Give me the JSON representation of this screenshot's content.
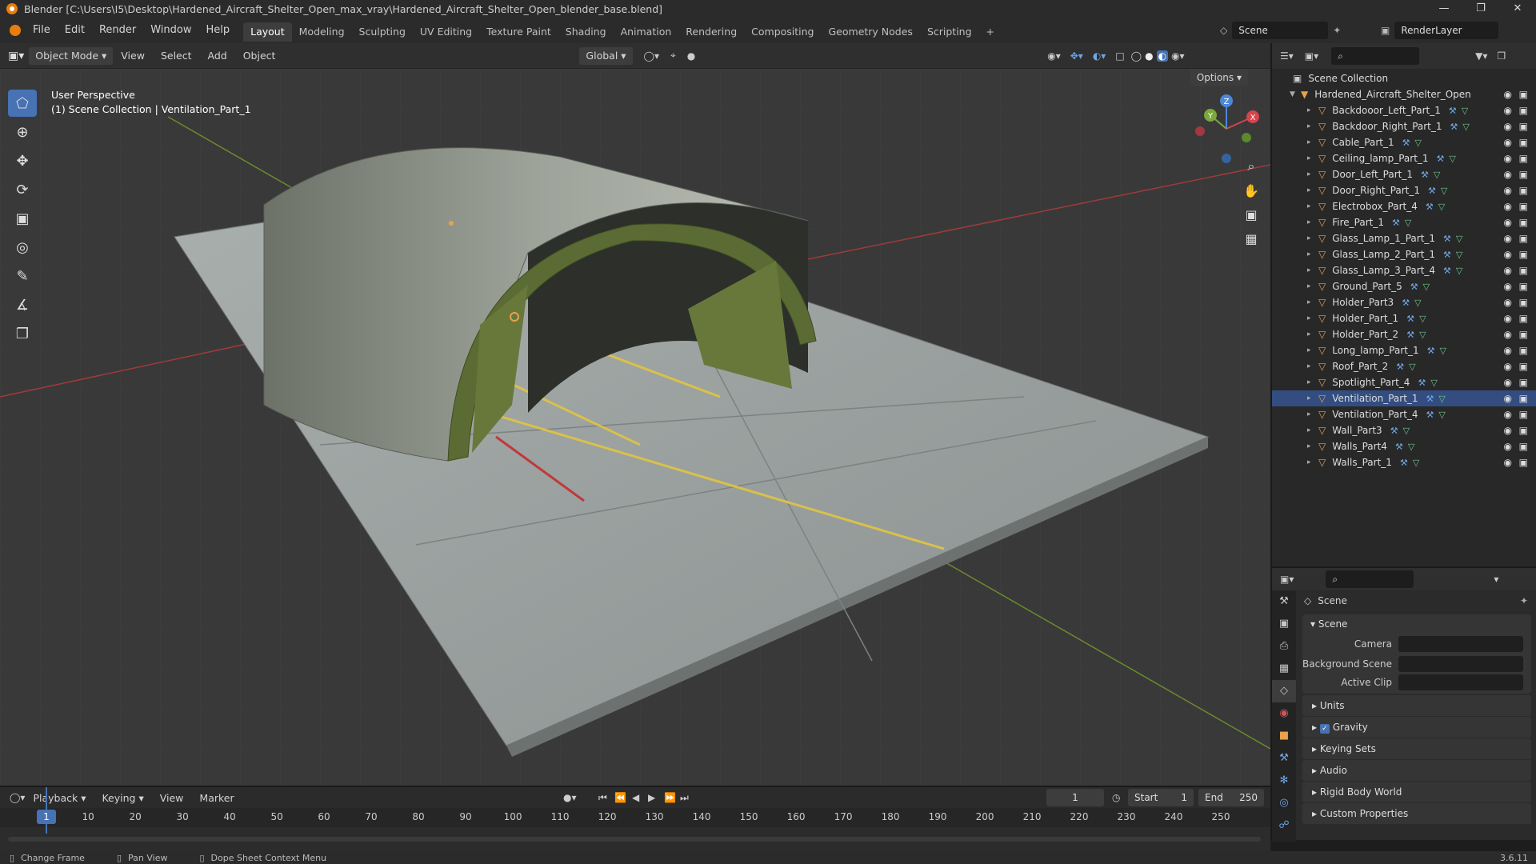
{
  "window": {
    "title": "Blender [C:\\Users\\I5\\Desktop\\Hardened_Aircraft_Shelter_Open_max_vray\\Hardened_Aircraft_Shelter_Open_blender_base.blend]"
  },
  "menu": [
    "File",
    "Edit",
    "Render",
    "Window",
    "Help"
  ],
  "workspaces": [
    "Layout",
    "Modeling",
    "Sculpting",
    "UV Editing",
    "Texture Paint",
    "Shading",
    "Animation",
    "Rendering",
    "Compositing",
    "Geometry Nodes",
    "Scripting"
  ],
  "active_workspace": "Layout",
  "scene_field": "Scene",
  "renderlayer_field": "RenderLayer",
  "viewport_header": {
    "mode": "Object Mode",
    "menus": [
      "View",
      "Select",
      "Add",
      "Object"
    ],
    "transform_orientation": "Global",
    "options_label": "Options"
  },
  "viewport": {
    "perspective_label": "User Perspective",
    "context_label": "(1) Scene Collection | Ventilation_Part_1"
  },
  "gizmo": {
    "x": "X",
    "y": "Y",
    "z": "Z"
  },
  "outliner": {
    "root": "Scene Collection",
    "collection": "Hardened_Aircraft_Shelter_Open",
    "items": [
      "Backdooor_Left_Part_1",
      "Backdoor_Right_Part_1",
      "Cable_Part_1",
      "Ceiling_lamp_Part_1",
      "Door_Left_Part_1",
      "Door_Right_Part_1",
      "Electrobox_Part_4",
      "Fire_Part_1",
      "Glass_Lamp_1_Part_1",
      "Glass_Lamp_2_Part_1",
      "Glass_Lamp_3_Part_4",
      "Ground_Part_5",
      "Holder_Part3",
      "Holder_Part_1",
      "Holder_Part_2",
      "Long_lamp_Part_1",
      "Roof_Part_2",
      "Spotlight_Part_4",
      "Ventilation_Part_1",
      "Ventilation_Part_4",
      "Wall_Part3",
      "Walls_Part4",
      "Walls_Part_1"
    ]
  },
  "properties": {
    "context_name": "Scene",
    "panel_title": "Scene",
    "rows": [
      {
        "label": "Camera",
        "value": ""
      },
      {
        "label": "Background Scene",
        "value": ""
      },
      {
        "label": "Active Clip",
        "value": ""
      }
    ],
    "subpanels": [
      "Units",
      "Gravity",
      "Keying Sets",
      "Audio",
      "Rigid Body World",
      "Custom Properties"
    ]
  },
  "timeline": {
    "menus": [
      "Playback",
      "Keying",
      "View",
      "Marker"
    ],
    "current_frame": "1",
    "start_label": "Start",
    "start": "1",
    "end_label": "End",
    "end": "250",
    "ticks": [
      "10",
      "20",
      "30",
      "40",
      "50",
      "60",
      "70",
      "80",
      "90",
      "100",
      "110",
      "120",
      "130",
      "140",
      "150",
      "160",
      "170",
      "180",
      "190",
      "200",
      "210",
      "220",
      "230",
      "240",
      "250"
    ]
  },
  "status": {
    "left": "Change Frame",
    "middle": "Pan View",
    "right": "Dope Sheet Context Menu",
    "version": "3.6.11"
  }
}
